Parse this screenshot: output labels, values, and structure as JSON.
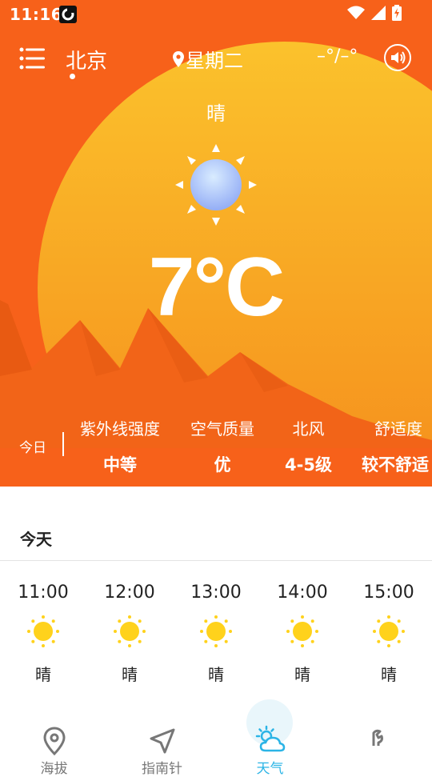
{
  "status_bar": {
    "time": "11:16"
  },
  "header": {
    "city": "北京",
    "weekday": "星期二",
    "temp_range": "–°/–°"
  },
  "current": {
    "condition": "晴",
    "temperature": "7°C"
  },
  "indices": {
    "today_label": "今日",
    "items": [
      {
        "label": "紫外线强度",
        "value": "中等"
      },
      {
        "label": "空气质量",
        "value": "优"
      },
      {
        "label": "北风",
        "value": "4-5级"
      },
      {
        "label": "舒适度",
        "value": "较不舒适"
      }
    ]
  },
  "forecast": {
    "title": "今天",
    "hours": [
      {
        "time": "11:00",
        "condition": "晴"
      },
      {
        "time": "12:00",
        "condition": "晴"
      },
      {
        "time": "13:00",
        "condition": "晴"
      },
      {
        "time": "14:00",
        "condition": "晴"
      },
      {
        "time": "15:00",
        "condition": "晴"
      }
    ]
  },
  "nav": {
    "items": [
      {
        "label": "海拔",
        "icon": "location-pin-icon"
      },
      {
        "label": "指南针",
        "icon": "compass-arrow-icon"
      },
      {
        "label": "天气",
        "icon": "weather-sun-cloud-icon"
      },
      {
        "label": "",
        "icon": "tools-icon"
      }
    ],
    "active_index": 2
  },
  "colors": {
    "background": "#f7611a",
    "sun_gradient_top": "#fbc22c",
    "sun_gradient_bottom": "#f58a1b",
    "mountains": "#f46d1e",
    "accent": "#2bb4e6",
    "hour_sun": "#ffd21c"
  }
}
